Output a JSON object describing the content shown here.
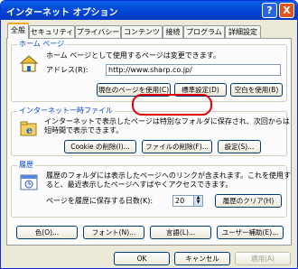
{
  "title": "インターネット オプション",
  "titlebar": {
    "help": "?",
    "close": "X"
  },
  "tabs": [
    "全般",
    "セキュリティ",
    "プライバシー",
    "コンテンツ",
    "接続",
    "プログラム",
    "詳細設定"
  ],
  "home": {
    "title": "ホーム ページ",
    "desc": "ホーム ページとして使用するページは変更できます。",
    "address_label": "アドレス(R):",
    "address_value": "http://www.sharp.co.jp/",
    "btn_current": "現在のページを使用(C)",
    "btn_default": "標準設定(D)",
    "btn_blank": "空白を使用(B)"
  },
  "temp": {
    "title": "インターネット一時ファイル",
    "desc1": "インターネットで表示したページは特別なフォルダに保存され、次回からは",
    "desc2": "短時間で表示できます。",
    "btn_cookie": "Cookie の削除(I)...",
    "btn_files": "ファイルの削除(F)...",
    "btn_settings": "設定(S)..."
  },
  "history": {
    "title": "履歴",
    "desc1": "履歴のフォルダには表示したページへのリンクが含まれます。これを使用す",
    "desc2": "ると、最近表示したページへすばやくアクセスできます。",
    "days_label": "ページを履歴に保存する日数(K):",
    "days_value": "20",
    "btn_clear": "履歴のクリア(H)"
  },
  "bottom": {
    "btn_color": "色(O)...",
    "btn_fonts": "フォント(N)...",
    "btn_lang": "言語(L)...",
    "btn_access": "ユーザー補助(E)..."
  },
  "footer": {
    "ok": "OK",
    "cancel": "キャンセル",
    "apply": "適用(A)"
  }
}
